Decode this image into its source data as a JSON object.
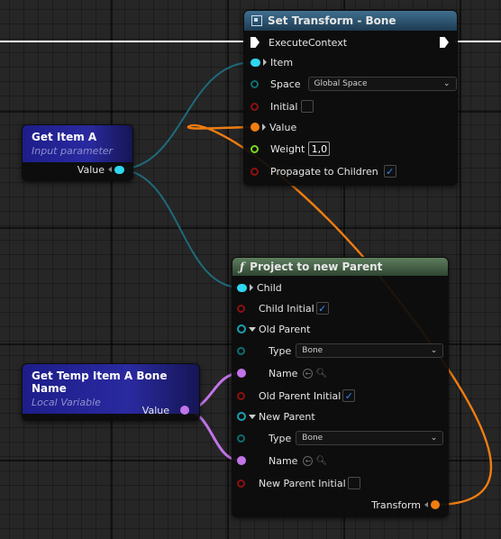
{
  "colors": {
    "exec": "#ffffff",
    "object_pin": "#2fd6f0",
    "struct_pin": "#17a2b0",
    "enum_pin": "#0e6e6e",
    "bool_pin": "#8c1010",
    "float_pin": "#79d51e",
    "name_pin": "#c173e8",
    "transform_pin": "#f07d10",
    "checkbox_on": "#2d8cff"
  },
  "set_transform": {
    "title": "Set Transform - Bone",
    "title_icon": "blueprint-function-icon",
    "exec_label": "ExecuteContext",
    "item_label": "Item",
    "space_label": "Space",
    "space_value": "Global Space",
    "initial_label": "Initial",
    "value_label": "Value",
    "weight_label": "Weight",
    "weight_value": "1,0",
    "propagate_label": "Propagate to Children",
    "propagate_checked": "✓"
  },
  "get_item": {
    "title": "Get Item A",
    "subtitle": "Input parameter",
    "value_label": "Value"
  },
  "project_parent": {
    "title": "Project to new Parent",
    "title_icon": "ƒ",
    "child_label": "Child",
    "child_initial_label": "Child Initial",
    "child_initial_checked": "✓",
    "old_parent_label": "Old Parent",
    "type_label": "Type",
    "type_value": "Bone",
    "name_label": "Name",
    "old_parent_initial_label": "Old Parent Initial",
    "old_parent_initial_checked": "✓",
    "new_parent_label": "New Parent",
    "type2_label": "Type",
    "type2_value": "Bone",
    "name2_label": "Name",
    "new_parent_initial_label": "New Parent Initial",
    "transform_label": "Transform"
  },
  "get_temp": {
    "title": "Get Temp Item A Bone Name",
    "subtitle": "Local Variable",
    "value_label": "Value"
  }
}
